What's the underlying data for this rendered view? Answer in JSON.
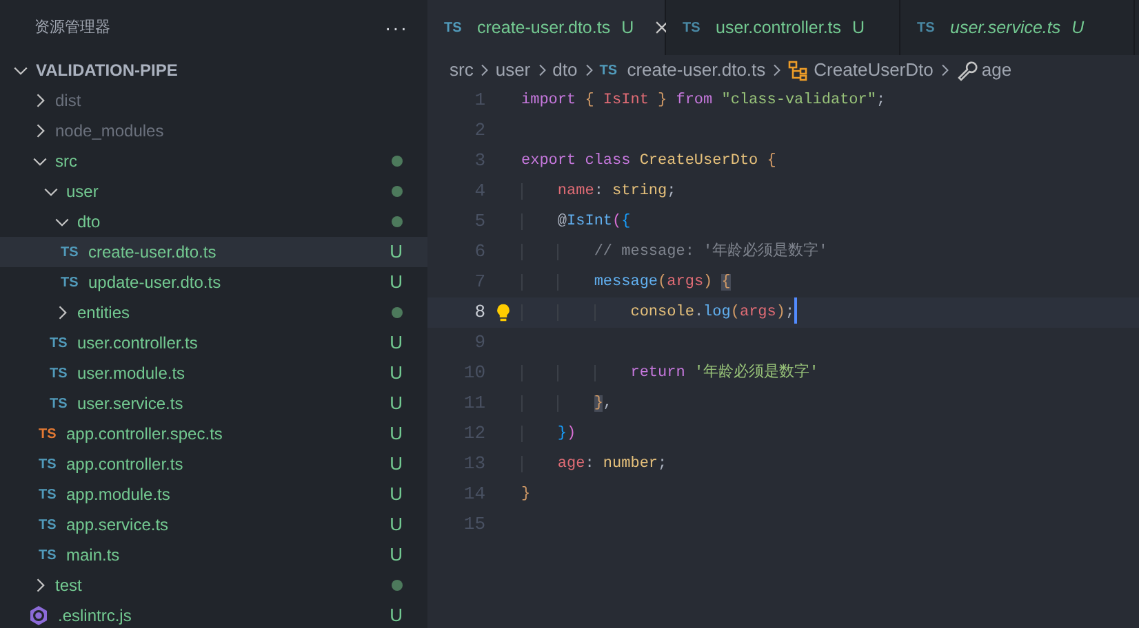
{
  "sidebar": {
    "title": "资源管理器",
    "more": "···",
    "project": {
      "label": "VALIDATION-PIPE",
      "expanded": true
    },
    "tree": [
      {
        "label": "dist",
        "kind": "folder",
        "expanded": false,
        "ignored": true,
        "untracked": false,
        "changed": false,
        "selected": false
      },
      {
        "label": "node_modules",
        "kind": "folder",
        "expanded": false,
        "ignored": true,
        "untracked": false,
        "changed": false,
        "selected": false
      },
      {
        "label": "src",
        "kind": "folder",
        "expanded": true,
        "ignored": false,
        "untracked": true,
        "changed": true,
        "selected": false,
        "children": [
          {
            "label": "user",
            "kind": "folder",
            "expanded": true,
            "ignored": false,
            "untracked": true,
            "changed": true,
            "selected": false,
            "children": [
              {
                "label": "dto",
                "kind": "folder",
                "expanded": true,
                "ignored": false,
                "untracked": true,
                "changed": true,
                "selected": false,
                "children": [
                  {
                    "label": "create-user.dto.ts",
                    "kind": "ts",
                    "icon_text": "TS",
                    "badge": "U",
                    "ignored": false,
                    "untracked": true,
                    "selected": true
                  },
                  {
                    "label": "update-user.dto.ts",
                    "kind": "ts",
                    "icon_text": "TS",
                    "badge": "U",
                    "ignored": false,
                    "untracked": true,
                    "selected": false
                  }
                ]
              },
              {
                "label": "entities",
                "kind": "folder",
                "expanded": false,
                "ignored": false,
                "untracked": true,
                "changed": true,
                "selected": false
              },
              {
                "label": "user.controller.ts",
                "kind": "ts",
                "icon_text": "TS",
                "badge": "U",
                "ignored": false,
                "untracked": true,
                "selected": false
              },
              {
                "label": "user.module.ts",
                "kind": "ts",
                "icon_text": "TS",
                "badge": "U",
                "ignored": false,
                "untracked": true,
                "selected": false
              },
              {
                "label": "user.service.ts",
                "kind": "ts",
                "icon_text": "TS",
                "badge": "U",
                "ignored": false,
                "untracked": true,
                "selected": false
              }
            ]
          },
          {
            "label": "app.controller.spec.ts",
            "kind": "spec",
            "icon_text": "TS",
            "badge": "U",
            "ignored": false,
            "untracked": true,
            "selected": false
          },
          {
            "label": "app.controller.ts",
            "kind": "ts",
            "icon_text": "TS",
            "badge": "U",
            "ignored": false,
            "untracked": true,
            "selected": false
          },
          {
            "label": "app.module.ts",
            "kind": "ts",
            "icon_text": "TS",
            "badge": "U",
            "ignored": false,
            "untracked": true,
            "selected": false
          },
          {
            "label": "app.service.ts",
            "kind": "ts",
            "icon_text": "TS",
            "badge": "U",
            "ignored": false,
            "untracked": true,
            "selected": false
          },
          {
            "label": "main.ts",
            "kind": "ts",
            "icon_text": "TS",
            "badge": "U",
            "ignored": false,
            "untracked": true,
            "selected": false
          }
        ]
      },
      {
        "label": "test",
        "kind": "folder",
        "expanded": false,
        "ignored": false,
        "untracked": true,
        "changed": true,
        "selected": false
      },
      {
        "label": ".eslintrc.js",
        "kind": "eslint",
        "badge": "U",
        "ignored": false,
        "untracked": true,
        "selected": false
      }
    ]
  },
  "tabs": [
    {
      "icon_text": "TS",
      "label": "create-user.dto.ts",
      "badge": "U",
      "selected": true,
      "preview": false
    },
    {
      "icon_text": "TS",
      "label": "user.controller.ts",
      "badge": "U",
      "selected": false,
      "preview": false
    },
    {
      "icon_text": "TS",
      "label": "user.service.ts",
      "badge": "U",
      "selected": false,
      "preview": true
    }
  ],
  "breadcrumb": [
    {
      "kind": "folder",
      "label": "src"
    },
    {
      "kind": "folder",
      "label": "user"
    },
    {
      "kind": "folder",
      "label": "dto"
    },
    {
      "kind": "file",
      "icon_text": "TS",
      "label": "create-user.dto.ts"
    },
    {
      "kind": "class",
      "label": "CreateUserDto"
    },
    {
      "kind": "property",
      "label": "age"
    }
  ],
  "code": [
    {
      "number": "1",
      "tokens": [
        {
          "kind": "keyword",
          "text": "import "
        },
        {
          "kind": "brace",
          "text": "{ "
        },
        {
          "kind": "property",
          "text": "IsInt "
        },
        {
          "kind": "brace",
          "text": "} "
        },
        {
          "kind": "keyword",
          "text": "from "
        },
        {
          "kind": "string",
          "text": "\"class-validator\""
        },
        {
          "kind": "plain",
          "text": ";"
        }
      ]
    },
    {
      "number": "2"
    },
    {
      "number": "3",
      "tokens": [
        {
          "kind": "keyword",
          "text": "export class "
        },
        {
          "kind": "type",
          "text": "CreateUserDto "
        },
        {
          "kind": "brace",
          "text": "{"
        }
      ]
    },
    {
      "number": "4",
      "tokens": [
        {
          "kind": "property",
          "text": "    name"
        },
        {
          "kind": "plain",
          "text": ": "
        },
        {
          "kind": "type",
          "text": "string"
        },
        {
          "kind": "plain",
          "text": ";"
        }
      ]
    },
    {
      "number": "5",
      "tokens": [
        {
          "kind": "plain",
          "text": "    @"
        },
        {
          "kind": "function",
          "text": "IsInt"
        },
        {
          "kind": "brace2",
          "text": "("
        },
        {
          "kind": "brace3",
          "text": "{"
        }
      ]
    },
    {
      "number": "6",
      "tokens": [
        {
          "kind": "comment",
          "text": "        // message: '年龄必须是数字'"
        }
      ]
    },
    {
      "number": "7",
      "tokens": [
        {
          "kind": "function",
          "text": "        message"
        },
        {
          "kind": "brace",
          "text": "("
        },
        {
          "kind": "property",
          "text": "args"
        },
        {
          "kind": "brace",
          "text": ") "
        },
        {
          "kind": "match",
          "text": "{"
        }
      ]
    },
    {
      "number": "8",
      "current": true,
      "lightbulb": true,
      "cursor": true,
      "tokens": [
        {
          "kind": "type",
          "text": "            console"
        },
        {
          "kind": "plain",
          "text": "."
        },
        {
          "kind": "function",
          "text": "log"
        },
        {
          "kind": "brace",
          "text": "("
        },
        {
          "kind": "property",
          "text": "args"
        },
        {
          "kind": "brace",
          "text": ")"
        },
        {
          "kind": "plain",
          "text": ";"
        }
      ]
    },
    {
      "number": "9"
    },
    {
      "number": "10",
      "tokens": [
        {
          "kind": "keyword",
          "text": "            return "
        },
        {
          "kind": "string",
          "text": "'年龄必须是数字'"
        }
      ]
    },
    {
      "number": "11",
      "tokens": [
        {
          "kind": "match",
          "text": "        }"
        },
        {
          "kind": "plain",
          "text": ","
        }
      ]
    },
    {
      "number": "12",
      "tokens": [
        {
          "kind": "brace3",
          "text": "    }"
        },
        {
          "kind": "brace2",
          "text": ")"
        }
      ]
    },
    {
      "number": "13",
      "tokens": [
        {
          "kind": "property",
          "text": "    age"
        },
        {
          "kind": "plain",
          "text": ": "
        },
        {
          "kind": "type",
          "text": "number"
        },
        {
          "kind": "plain",
          "text": ";"
        }
      ]
    },
    {
      "number": "14",
      "tokens": [
        {
          "kind": "brace",
          "text": "}"
        }
      ]
    },
    {
      "number": "15"
    }
  ]
}
